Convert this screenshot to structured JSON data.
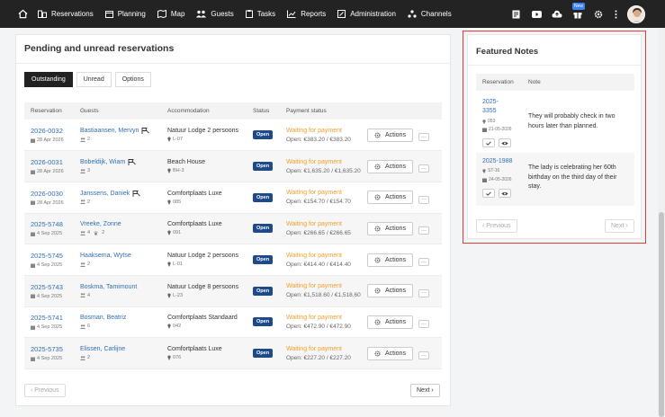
{
  "nav": {
    "items": [
      {
        "label": "Reservations",
        "icon": "buildings-icon"
      },
      {
        "label": "Planning",
        "icon": "calendar-icon"
      },
      {
        "label": "Map",
        "icon": "map-icon"
      },
      {
        "label": "Guests",
        "icon": "users-icon"
      },
      {
        "label": "Tasks",
        "icon": "clipboard-icon"
      },
      {
        "label": "Reports",
        "icon": "chart-icon"
      },
      {
        "label": "Administration",
        "icon": "document-icon"
      },
      {
        "label": "Channels",
        "icon": "channels-icon"
      }
    ],
    "new_badge": "New"
  },
  "main": {
    "title": "Pending and unread reservations",
    "tabs": [
      {
        "label": "Outstanding",
        "active": true
      },
      {
        "label": "Unread",
        "active": false
      },
      {
        "label": "Options",
        "active": false
      }
    ],
    "columns": [
      "Reservation",
      "Guests",
      "Accommodation",
      "Status",
      "Payment status"
    ],
    "rows": [
      {
        "res": "2026-0032",
        "date": "28 Apr 2026",
        "guests": "Bastiaansen, Mervyn",
        "count": "2",
        "pets": "",
        "flag": true,
        "acc": "Natuur Lodge 2 persoons",
        "loc": "L-07",
        "status": "Open",
        "pay": "Waiting for payment",
        "open": "Open: €383.20 / €383.20"
      },
      {
        "res": "2026-0031",
        "date": "28 Apr 2026",
        "guests": "Bobeldijk, Wiam",
        "count": "3",
        "pets": "",
        "flag": true,
        "acc": "Beach House",
        "loc": "BH-3",
        "status": "Open",
        "pay": "Waiting for payment",
        "open": "Open: €1,635.20 / €1,635.20"
      },
      {
        "res": "2026-0030",
        "date": "28 Apr 2026",
        "guests": "Janssens, Daniek",
        "count": "2",
        "pets": "",
        "flag": true,
        "acc": "Comfortplaats Luxe",
        "loc": "085",
        "status": "Open",
        "pay": "Waiting for payment",
        "open": "Open: €154.70 / €154.70"
      },
      {
        "res": "2025-5748",
        "date": "4 Sep 2025",
        "guests": "Vreeke, Zonne",
        "count": "4",
        "pets": "2",
        "flag": false,
        "acc": "Comfortplaats Luxe",
        "loc": "091",
        "status": "Open",
        "pay": "Waiting for payment",
        "open": "Open: €266.65 / €266.65"
      },
      {
        "res": "2025-5745",
        "date": "4 Sep 2025",
        "guests": "Haaksema, Wytse",
        "count": "2",
        "pets": "",
        "flag": false,
        "acc": "Natuur Lodge 2 persoons",
        "loc": "L-01",
        "status": "Open",
        "pay": "Waiting for payment",
        "open": "Open: €414.40 / €414.40"
      },
      {
        "res": "2025-5743",
        "date": "4 Sep 2025",
        "guests": "Boskma, Tamimount",
        "count": "4",
        "pets": "",
        "flag": false,
        "acc": "Natuur Lodge 8 persoons",
        "loc": "L-23",
        "status": "Open",
        "pay": "Waiting for payment",
        "open": "Open: €1,518.60 / €1,518.60"
      },
      {
        "res": "2025-5741",
        "date": "4 Sep 2025",
        "guests": "Bosman, Beatriz",
        "count": "6",
        "pets": "",
        "flag": false,
        "acc": "Comfortplaats Standaard",
        "loc": "042",
        "status": "Open",
        "pay": "Waiting for payment",
        "open": "Open: €472.90 / €472.90"
      },
      {
        "res": "2025-5735",
        "date": "4 Sep 2025",
        "guests": "Elissen, Carlijne",
        "count": "2",
        "pets": "",
        "flag": false,
        "acc": "Comfortplaats Luxe",
        "loc": "076",
        "status": "Open",
        "pay": "Waiting for payment",
        "open": "Open: €227.20 / €227.20"
      }
    ],
    "actions_label": "Actions",
    "more_label": "···",
    "prev_label": "‹ Previous",
    "next_label": "Next ›"
  },
  "featured": {
    "title": "Featured Notes",
    "col_reservation": "Reservation",
    "col_note": "Note",
    "notes": [
      {
        "res_line1": "2025-",
        "res_line2": "3355",
        "loc": "053",
        "date": "21-05-2026",
        "note": "They will probably check in two hours later than planned."
      },
      {
        "res": "2025-1988",
        "loc": "ST-16",
        "date": "24-05-2026",
        "note": "The lady is celebrating her 60th birthday on the third day of their stay."
      }
    ],
    "prev_label": "‹ Previous",
    "next_label": "Next ›"
  }
}
